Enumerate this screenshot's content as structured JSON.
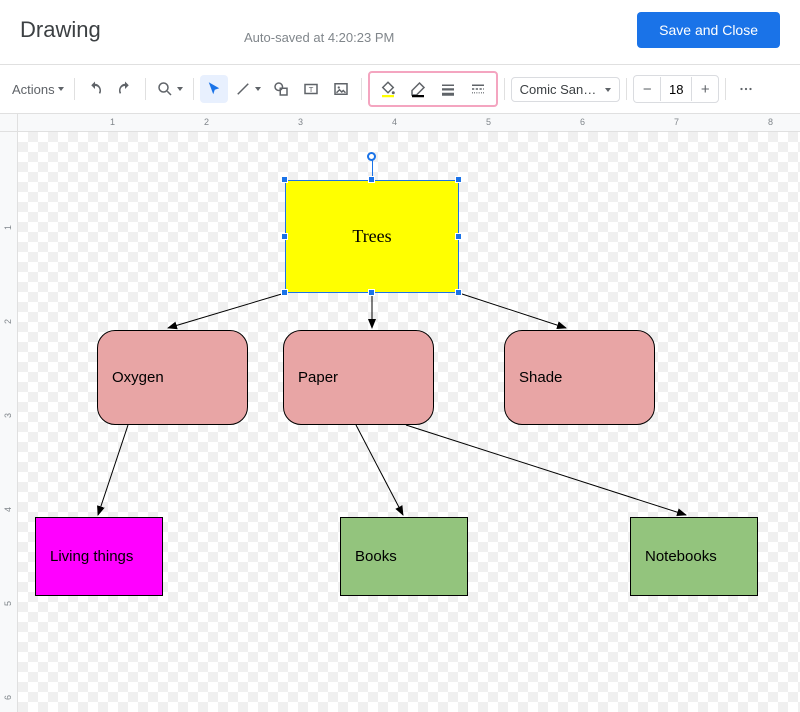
{
  "header": {
    "title": "Drawing",
    "autosave": "Auto-saved at 4:20:23 PM",
    "save_button": "Save and Close"
  },
  "toolbar": {
    "actions": "Actions",
    "font": "Comic San…",
    "font_size": "18"
  },
  "ruler": {
    "h": [
      "1",
      "2",
      "3",
      "4",
      "5",
      "6",
      "7",
      "8"
    ],
    "v": [
      "1",
      "2",
      "3",
      "4",
      "5",
      "6"
    ]
  },
  "nodes": {
    "trees": "Trees",
    "oxygen": "Oxygen",
    "paper": "Paper",
    "shade": "Shade",
    "living": "Living things",
    "books": "Books",
    "notebooks": "Notebooks"
  },
  "chart_data": {
    "type": "tree",
    "root": "Trees",
    "edges": [
      [
        "Trees",
        "Oxygen"
      ],
      [
        "Trees",
        "Paper"
      ],
      [
        "Trees",
        "Shade"
      ],
      [
        "Oxygen",
        "Living things"
      ],
      [
        "Paper",
        "Books"
      ],
      [
        "Paper",
        "Notebooks"
      ]
    ],
    "node_styles": {
      "Trees": {
        "fill": "#ffff00",
        "shape": "rect",
        "selected": true
      },
      "Oxygen": {
        "fill": "#e8a5a5",
        "shape": "rounded-rect"
      },
      "Paper": {
        "fill": "#e8a5a5",
        "shape": "rounded-rect"
      },
      "Shade": {
        "fill": "#e8a5a5",
        "shape": "rounded-rect"
      },
      "Living things": {
        "fill": "#ff00ff",
        "shape": "rect"
      },
      "Books": {
        "fill": "#93c47d",
        "shape": "rect"
      },
      "Notebooks": {
        "fill": "#93c47d",
        "shape": "rect"
      }
    }
  }
}
